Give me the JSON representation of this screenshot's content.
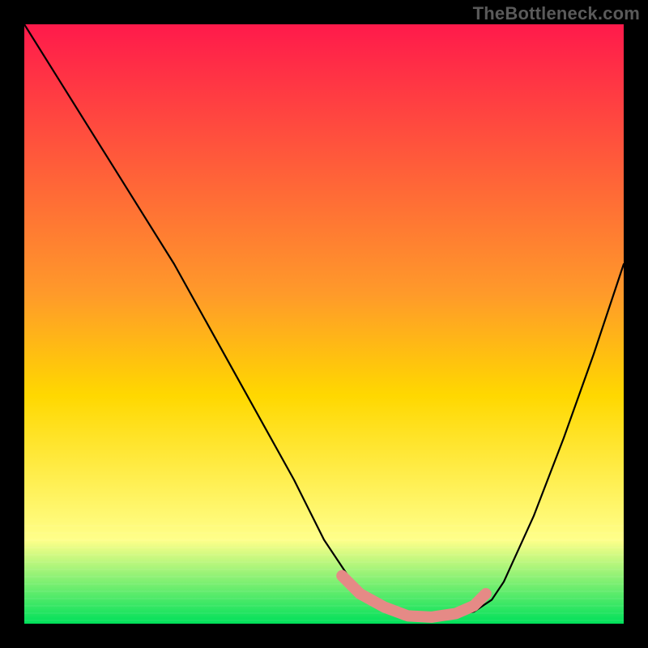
{
  "watermark": "TheBottleneck.com",
  "chart_data": {
    "type": "line",
    "title": "",
    "xlabel": "",
    "ylabel": "",
    "xlim": [
      0,
      100
    ],
    "ylim": [
      0,
      100
    ],
    "grid": false,
    "legend": false,
    "background_gradient": {
      "top_color": "#ff1a4b",
      "mid_color": "#ffd800",
      "lower_color": "#ffff8a",
      "bottom_color": "#00e05a"
    },
    "series": [
      {
        "name": "bottleneck-curve",
        "color": "#000000",
        "x": [
          0,
          5,
          10,
          15,
          20,
          25,
          30,
          35,
          40,
          45,
          50,
          55,
          60,
          65,
          70,
          75,
          78,
          80,
          85,
          90,
          95,
          100
        ],
        "values": [
          100,
          92,
          84,
          76,
          68,
          60,
          51,
          42,
          33,
          24,
          14,
          6.5,
          2.5,
          1.0,
          1.0,
          2.0,
          4,
          7,
          18,
          31,
          45,
          60
        ]
      },
      {
        "name": "highlight-band",
        "color": "#e58a86",
        "x": [
          53,
          56,
          60,
          64,
          68,
          72,
          75,
          77
        ],
        "values": [
          8.0,
          5.0,
          2.8,
          1.3,
          1.1,
          1.7,
          3.0,
          5.0
        ]
      }
    ]
  }
}
